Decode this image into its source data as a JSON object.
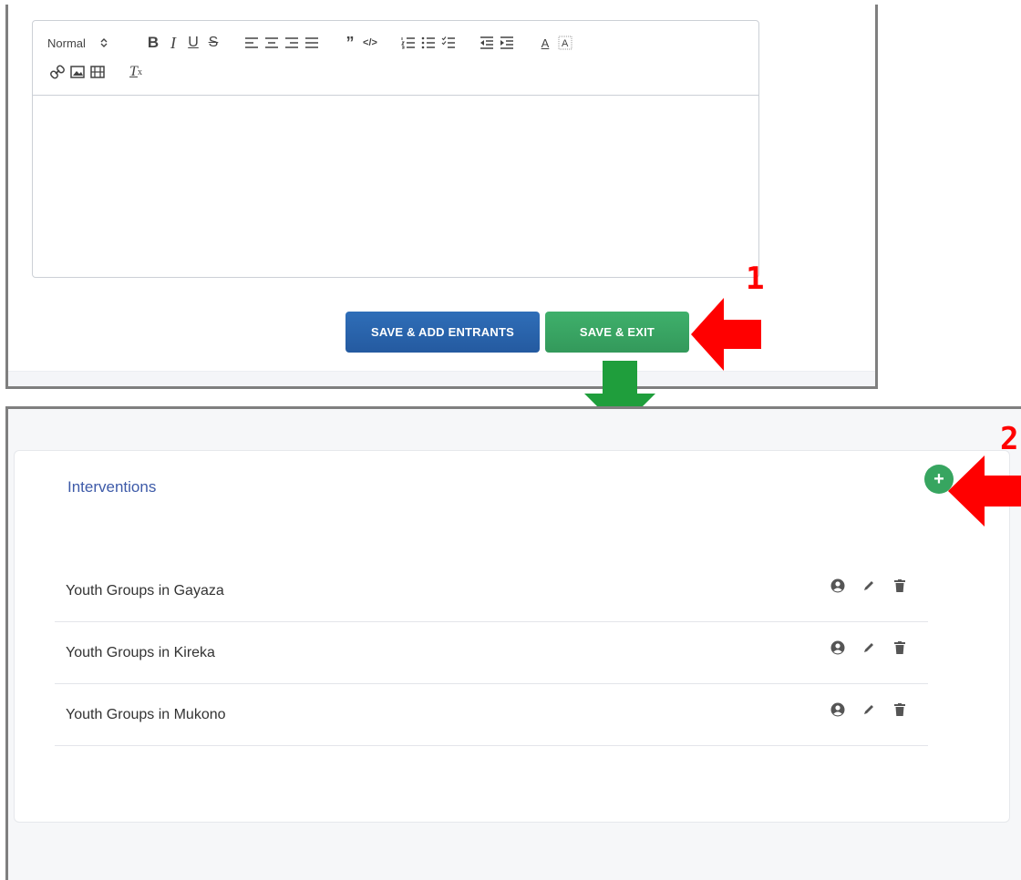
{
  "editor": {
    "format_select": "Normal"
  },
  "buttons": {
    "save_add_entrants": "SAVE & ADD ENTRANTS",
    "save_exit": "SAVE & EXIT"
  },
  "annotations": {
    "step1": "1",
    "step2": "2",
    "arrow_color": "#ff0000",
    "flow_arrow_color": "#1f9e3c"
  },
  "interventions": {
    "title": "Interventions",
    "add_button": "+",
    "items": [
      {
        "label": "Youth Groups in Gayaza"
      },
      {
        "label": "Youth Groups in Kireka"
      },
      {
        "label": "Youth Groups in Mukono"
      }
    ],
    "actions": [
      "user-circle-icon",
      "pencil-icon",
      "trash-icon"
    ]
  }
}
